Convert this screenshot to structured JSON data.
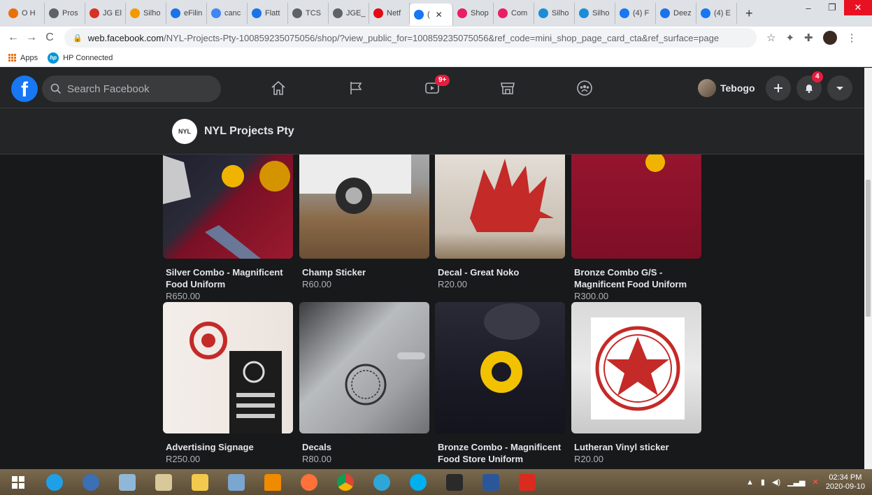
{
  "browser": {
    "tabs": [
      {
        "label": "O H",
        "color": "#e8710a"
      },
      {
        "label": "Pros",
        "color": "#5f6368"
      },
      {
        "label": "JG El",
        "color": "#d93025"
      },
      {
        "label": "Silho",
        "color": "#f29900"
      },
      {
        "label": "eFilin",
        "color": "#1a73e8"
      },
      {
        "label": "canc",
        "color": "#4285f4"
      },
      {
        "label": "Flatt",
        "color": "#1a73e8"
      },
      {
        "label": "TCS",
        "color": "#5f6368"
      },
      {
        "label": "JGE_",
        "color": "#5f6368"
      },
      {
        "label": "Netf",
        "color": "#e50914"
      },
      {
        "label": "(",
        "color": "#1877f2",
        "active": true
      },
      {
        "label": "Shop",
        "color": "#e91e63"
      },
      {
        "label": "Com",
        "color": "#e91e63"
      },
      {
        "label": "Silho",
        "color": "#1a8cd8"
      },
      {
        "label": "Silho",
        "color": "#1a8cd8"
      },
      {
        "label": "(4) F",
        "color": "#1877f2"
      },
      {
        "label": "Deez",
        "color": "#1a73e8"
      },
      {
        "label": "(4) E",
        "color": "#1877f2"
      }
    ],
    "new_tab": "+",
    "url_host": "web.facebook.com",
    "url_rest": "/NYL-Projects-Pty-100859235075056/shop/?view_public_for=100859235075056&ref_code=mini_shop_page_card_cta&ref_surface=page",
    "bookmarks": [
      {
        "label": "Apps"
      },
      {
        "label": "HP Connected"
      }
    ]
  },
  "facebook": {
    "search_placeholder": "Search Facebook",
    "watch_badge": "9+",
    "user_name": "Tebogo",
    "notifications_badge": "4",
    "page_name": "NYL Projects Pty",
    "page_logo_text": "NYL"
  },
  "products": [
    {
      "title": "Silver Combo - Magnificent Food Uniform",
      "price": "R650.00",
      "image": "tshirt-combo"
    },
    {
      "title": "Champ Sticker",
      "price": "R60.00",
      "image": "car-wheel"
    },
    {
      "title": "Decal - Great Noko",
      "price": "R20.00",
      "image": "porcupine-decal"
    },
    {
      "title": "Bronze Combo G/S - Magnificent Food Uniform",
      "price": "R300.00",
      "image": "red-shirt"
    },
    {
      "title": "Advertising Signage",
      "price": "R250.00",
      "image": "signage"
    },
    {
      "title": "Decals",
      "price": "R80.00",
      "image": "car-decal"
    },
    {
      "title": "Bronze Combo - Magnificent Food Store Uniform",
      "price": "",
      "image": "cap-shirt"
    },
    {
      "title": "Lutheran Vinyl sticker",
      "price": "R20.00",
      "image": "lutheran-seal"
    }
  ],
  "taskbar": {
    "time": "02:34 PM",
    "date": "2020-09-10"
  }
}
